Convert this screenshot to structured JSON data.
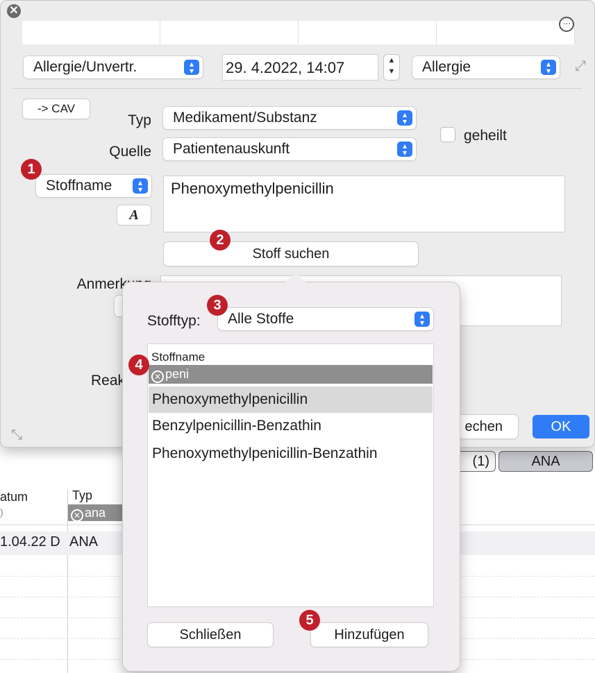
{
  "main_dialog": {
    "category_popup": "Allergie/Unvertr.",
    "datetime": "29.  4.2022, 14:07",
    "type_popup": "Allergie",
    "cav_button": "-> CAV",
    "typ_label": "Typ",
    "typ_value": "Medikament/Substanz",
    "quelle_label": "Quelle",
    "quelle_value": "Patientenauskunft",
    "geheilt_label": "geheilt",
    "stoffname_popup": "Stoffname",
    "font_button": "A",
    "substance_text": "Phenoxymethylpenicillin",
    "search_button": "Stoff suchen",
    "anmerkung_label": "Anmerkung",
    "reaktion_label": "Reak",
    "cancel_button": "echen",
    "ok_button": "OK"
  },
  "popover": {
    "stofftyp_label": "Stofftyp:",
    "stofftyp_value": "Alle Stoffe",
    "column_header": "Stoffname",
    "filter_value": "peni",
    "items": [
      "Phenoxymethylpenicillin",
      "Benzylpenicillin-Benzathin",
      "Phenoxymethylpenicillin-Benzathin"
    ],
    "close_button": "Schließen",
    "add_button": "Hinzufügen"
  },
  "background": {
    "tab_partial": "(1)",
    "tab_ana": "ANA",
    "col_datum": "atum",
    "col_datum_sub": ")",
    "col_typ": "Typ",
    "typ_filter": "ana",
    "row_date": "1.04.22  D",
    "row_typ": "ANA"
  },
  "badges": [
    "1",
    "2",
    "3",
    "4",
    "5"
  ],
  "colors": {
    "accent": "#2f7cf6",
    "badge": "#c0202a"
  }
}
